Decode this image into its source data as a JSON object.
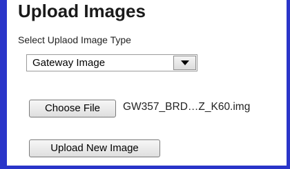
{
  "title": "Upload Images",
  "select_label": "Select Uplaod Image Type",
  "image_type_select": {
    "selected_value": "Gateway Image",
    "arrow_icon": "triangle-down"
  },
  "file_input": {
    "button_label": "Choose File",
    "file_name": "GW357_BRD…Z_K60.img"
  },
  "upload_button_label": "Upload New Image",
  "colors": {
    "frame_border": "#2a35c9"
  }
}
